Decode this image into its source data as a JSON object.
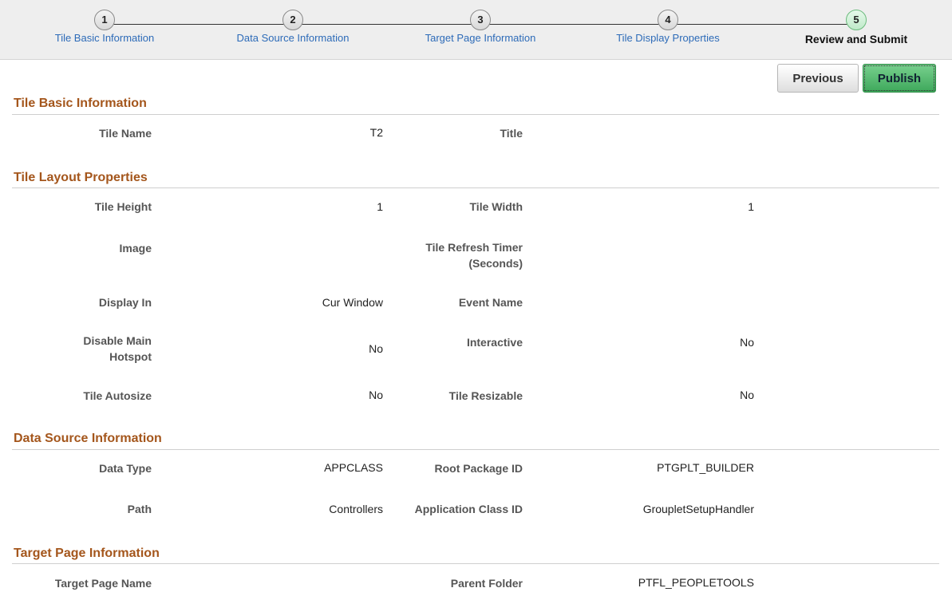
{
  "train": {
    "steps": [
      {
        "num": "1",
        "label": "Tile Basic Information"
      },
      {
        "num": "2",
        "label": "Data Source Information"
      },
      {
        "num": "3",
        "label": "Target Page Information"
      },
      {
        "num": "4",
        "label": "Tile Display Properties"
      },
      {
        "num": "5",
        "label": "Review and Submit"
      }
    ]
  },
  "buttons": {
    "previous": "Previous",
    "publish": "Publish"
  },
  "basic": {
    "title": "Tile Basic Information",
    "tile_name_label": "Tile Name",
    "tile_name_value": "T2",
    "title_label": "Title",
    "title_value": ""
  },
  "layout": {
    "title": "Tile Layout Properties",
    "tile_height_label": "Tile Height",
    "tile_height_value": "1",
    "tile_width_label": "Tile Width",
    "tile_width_value": "1",
    "image_label": "Image",
    "image_value": "",
    "refresh_label_1": "Tile Refresh Timer",
    "refresh_label_2": "(Seconds)",
    "refresh_value": "",
    "display_in_label": "Display In",
    "display_in_value": "Cur Window",
    "event_name_label": "Event Name",
    "event_name_value": "",
    "disable_hotspot_label_1": "Disable Main",
    "disable_hotspot_label_2": "Hotspot",
    "disable_hotspot_value": "No",
    "interactive_label": "Interactive",
    "interactive_value": "No",
    "autosize_label": "Tile Autosize",
    "autosize_value": "No",
    "resizable_label": "Tile Resizable",
    "resizable_value": "No"
  },
  "datasource": {
    "title": "Data Source Information",
    "data_type_label": "Data Type",
    "data_type_value": "APPCLASS",
    "root_pkg_label": "Root Package ID",
    "root_pkg_value": "PTGPLT_BUILDER",
    "path_label": "Path",
    "path_value": "Controllers",
    "app_class_label": "Application Class ID",
    "app_class_value": "GroupletSetupHandler"
  },
  "target": {
    "title": "Target Page Information",
    "page_name_label": "Target Page Name",
    "page_name_value": "",
    "parent_folder_label": "Parent Folder",
    "parent_folder_value": "PTFL_PEOPLETOOLS"
  }
}
